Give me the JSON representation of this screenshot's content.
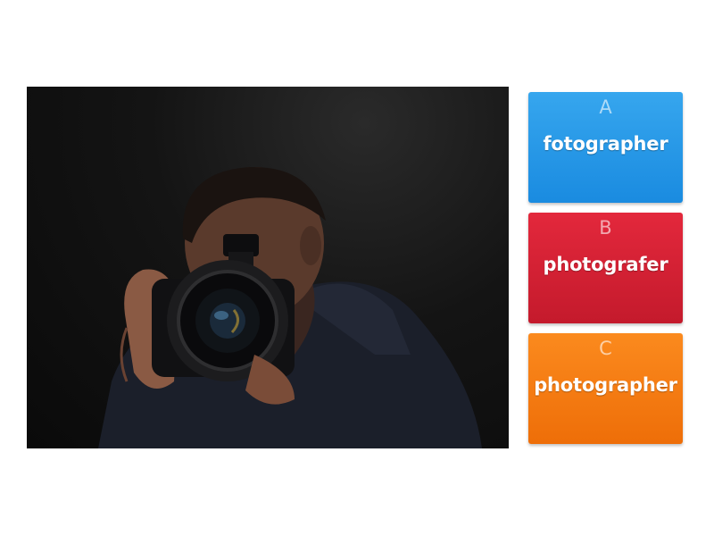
{
  "question_image": {
    "description_icon": "photographer-image"
  },
  "answers": [
    {
      "letter": "A",
      "text": "fotographer",
      "color": "#1f93e6"
    },
    {
      "letter": "B",
      "text": "photografer",
      "color": "#d42034"
    },
    {
      "letter": "C",
      "text": "photographer",
      "color": "#f57c12"
    }
  ]
}
